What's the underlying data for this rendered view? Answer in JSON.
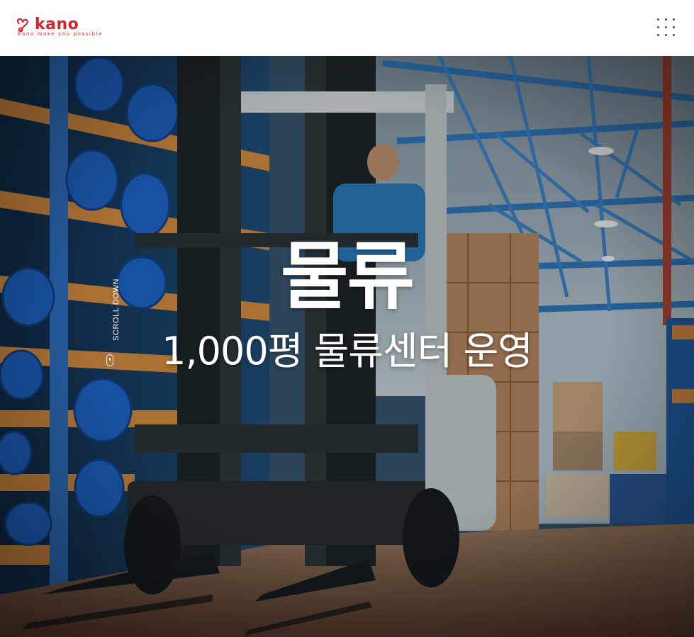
{
  "header": {
    "logo": {
      "wordmark": "kano",
      "tagline": "Kano make you possible"
    },
    "menu_icon": "grid-menu-icon"
  },
  "hero": {
    "title": "물류",
    "subtitle": "1,000평 물류센터 운영",
    "background": "warehouse-forklift-photo",
    "scroll_down_label": "SCROLL DOWN",
    "scroll_icon": "mouse-scroll-icon"
  },
  "colors": {
    "brand": "#d8212a",
    "overlay_text": "#ffffff",
    "header_bg": "#ffffff"
  }
}
